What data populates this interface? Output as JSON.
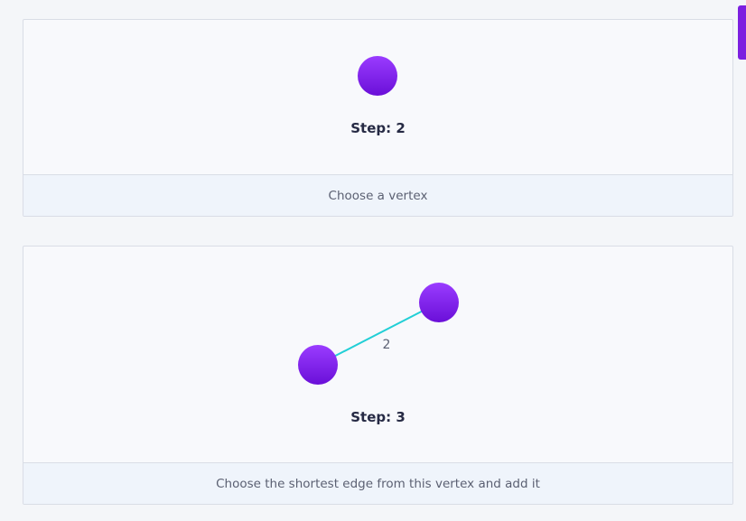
{
  "steps": [
    {
      "step_label": "Step: 2",
      "description": "Choose a vertex",
      "vertices": [
        {
          "id": "v1"
        }
      ],
      "edges": []
    },
    {
      "step_label": "Step: 3",
      "description": "Choose the shortest edge from this vertex and add it",
      "vertices": [
        {
          "id": "v1"
        },
        {
          "id": "v2"
        }
      ],
      "edges": [
        {
          "from": "v1",
          "to": "v2",
          "weight": "2"
        }
      ]
    }
  ],
  "colors": {
    "vertex_top": "#9a3cff",
    "vertex_bottom": "#6a0fd8",
    "edge": "#22cfd6"
  }
}
